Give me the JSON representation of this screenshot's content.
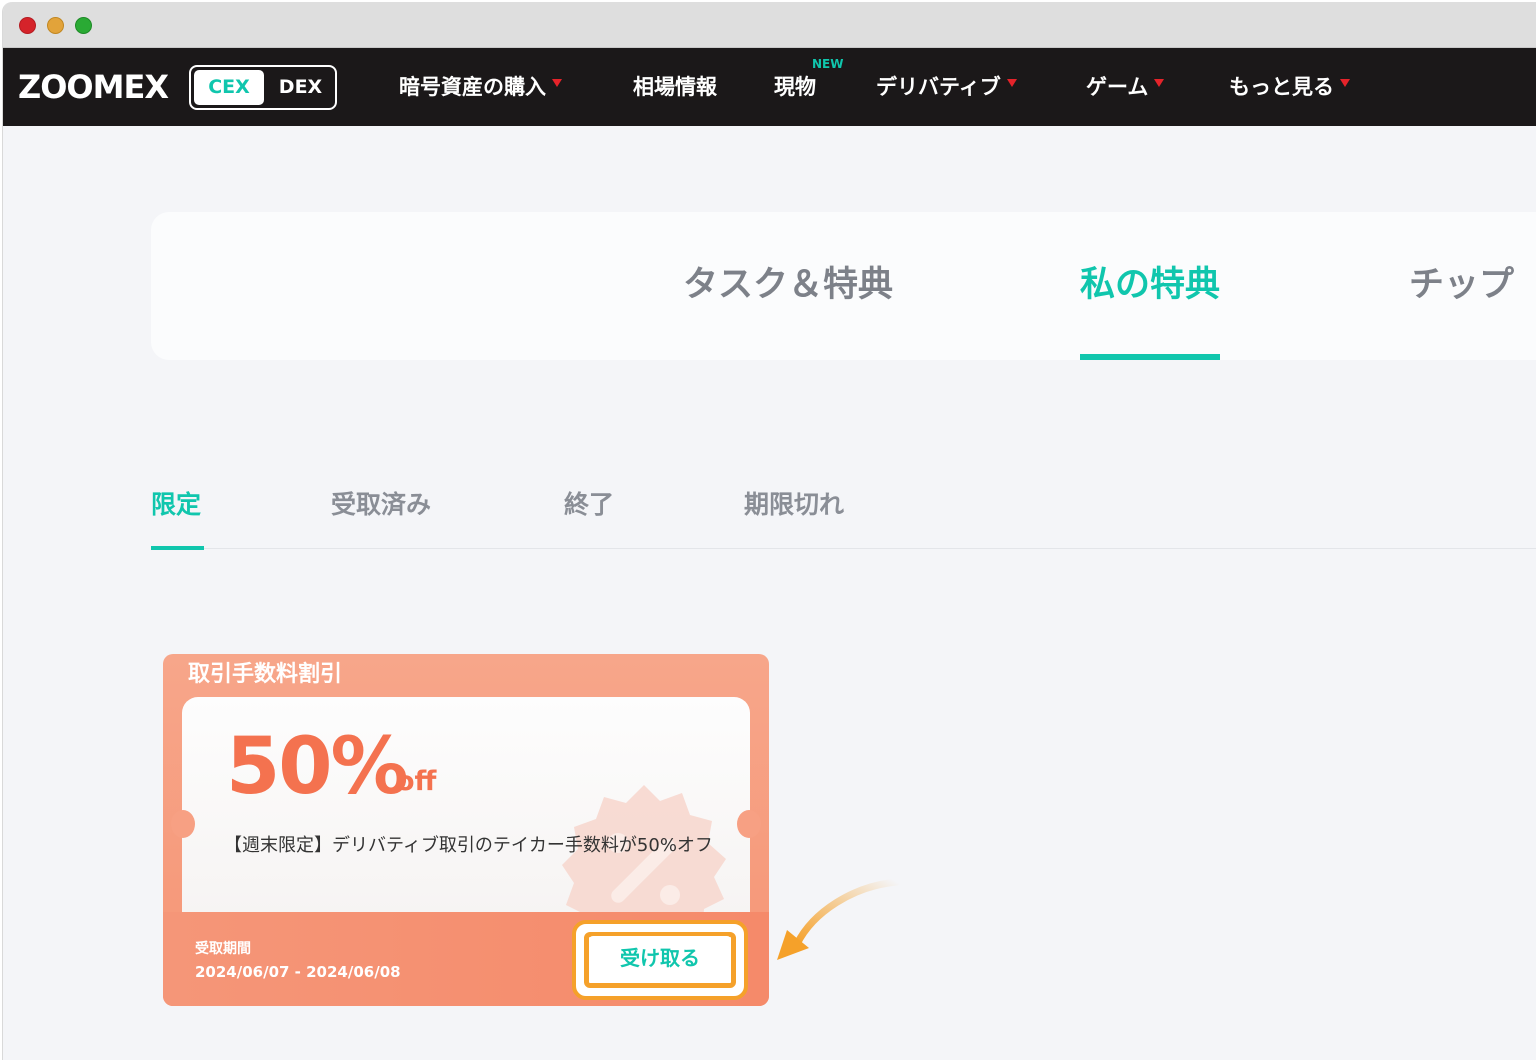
{
  "window": {
    "controls": [
      "close",
      "minimize",
      "maximize"
    ]
  },
  "nav": {
    "logo": "ZOOMEX",
    "switch": {
      "cex": "CEX",
      "dex": "DEX",
      "selected": "CEX"
    },
    "items": [
      {
        "label": "暗号資産の購入",
        "dropdown": true
      },
      {
        "label": "相場情報",
        "dropdown": false
      },
      {
        "label": "現物",
        "dropdown": false,
        "badge": "NEW"
      },
      {
        "label": "デリバティブ",
        "dropdown": true
      },
      {
        "label": "ゲーム",
        "dropdown": true
      },
      {
        "label": "もっと見る",
        "dropdown": true
      }
    ]
  },
  "main_tabs": [
    {
      "label": "タスク＆特典",
      "active": false
    },
    {
      "label": "私の特典",
      "active": true
    },
    {
      "label": "チップ",
      "active": false
    }
  ],
  "sub_tabs": [
    {
      "label": "限定",
      "active": true
    },
    {
      "label": "受取済み",
      "active": false
    },
    {
      "label": "終了",
      "active": false
    },
    {
      "label": "期限切れ",
      "active": false
    }
  ],
  "coupon": {
    "title": "取引手数料割引",
    "percent": "50%",
    "off": "off",
    "description": "【週末限定】デリバティブ取引のテイカー手数料が50%オフ",
    "period_label": "受取期間",
    "period_value": "2024/06/07 - 2024/06/08",
    "claim_button": "受け取る"
  },
  "colors": {
    "accent": "#10c6ad",
    "nav_bg": "#1b1819",
    "coupon_orange": "#f4724f",
    "highlight": "#f5a12a",
    "caret_red": "#e5232a"
  }
}
